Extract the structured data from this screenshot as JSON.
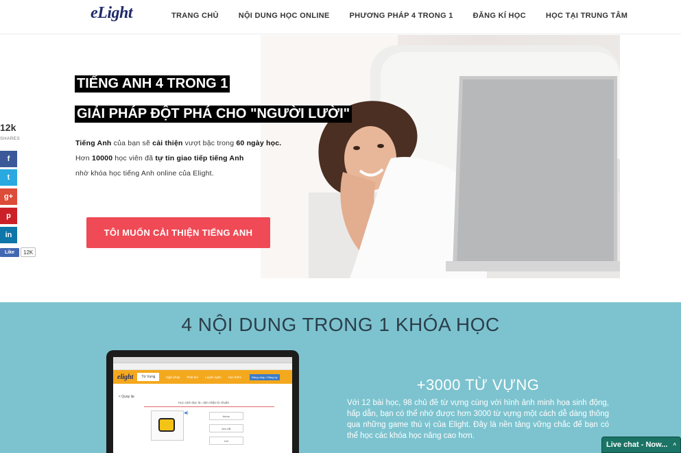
{
  "brand": {
    "logo": "eLight"
  },
  "nav": {
    "items": [
      {
        "label": "TRANG CHỦ"
      },
      {
        "label": "NỘI DUNG HỌC ONLINE"
      },
      {
        "label": "PHƯƠNG PHÁP 4 TRONG 1"
      },
      {
        "label": "ĐĂNG KÍ HỌC"
      },
      {
        "label": "HỌC TẠI TRUNG TÂM"
      }
    ]
  },
  "hero": {
    "title_line1": "TIẾNG ANH 4 TRONG 1",
    "title_line2": "GIẢI PHÁP ĐỘT PHÁ CHO \"NGƯỜI LƯỜI\"",
    "p1_a": "Tiếng Anh",
    "p1_b": " của bạn sẽ ",
    "p1_c": "cải thiện",
    "p1_d": " vượt bậc trong ",
    "p1_e": "60 ngày học.",
    "p2_a": "Hơn ",
    "p2_b": "10000",
    "p2_c": " học viên đã ",
    "p2_d": "tự tin giao tiếp tiếng Anh",
    "p3": "nhờ khóa học tiếng Anh online của Elight.",
    "cta_label": "TÔI MUỐN CẢI THIỆN TIẾNG ANH"
  },
  "share": {
    "count": "12k",
    "label": "SHARES",
    "buttons": [
      {
        "icon": "facebook-icon",
        "glyph": "f",
        "color": "#3b5998"
      },
      {
        "icon": "twitter-icon",
        "glyph": "t",
        "color": "#2aa9e0"
      },
      {
        "icon": "google-plus-icon",
        "glyph": "g+",
        "color": "#dd4b39"
      },
      {
        "icon": "pinterest-icon",
        "glyph": "p",
        "color": "#cb2027"
      },
      {
        "icon": "linkedin-icon",
        "glyph": "in",
        "color": "#0e76a8"
      }
    ],
    "like_label": "Like",
    "like_count": "12K"
  },
  "section2": {
    "title": "4 NỘI DUNG TRONG 1 KHÓA HỌC",
    "subtitle": "+3000 TỪ VỰNG",
    "body": "Với 12 bài học, 98 chủ đề từ vựng cùng với hình ảnh minh họa sinh động, hấp dẫn, bạn có thể nhớ được hơn 3000 từ vựng một cách dễ dàng thông qua những game thú vị của Elight. Đây là nền tảng vững chắc để bạn có thể học các khóa học nâng cao hơn.",
    "laptop": {
      "logo": "elight",
      "tab": "Từ Vựng",
      "menu": [
        "Ngữ pháp",
        "Phát âm",
        "Luyện nghe",
        "Học thêm"
      ],
      "button": "Đăng nhập / Đăng ký",
      "back": "< Quay lại",
      "question": "Học cách đọc từ, cảm nhận từ chuẩn",
      "options": [
        "thước",
        "kéo cắt",
        "bút"
      ]
    }
  },
  "livechat": {
    "label": "Live chat - Now...",
    "caret": "^"
  },
  "colors": {
    "accent": "#ef4a55",
    "section_bg": "#7cc3cf",
    "livechat": "#1b7466"
  }
}
